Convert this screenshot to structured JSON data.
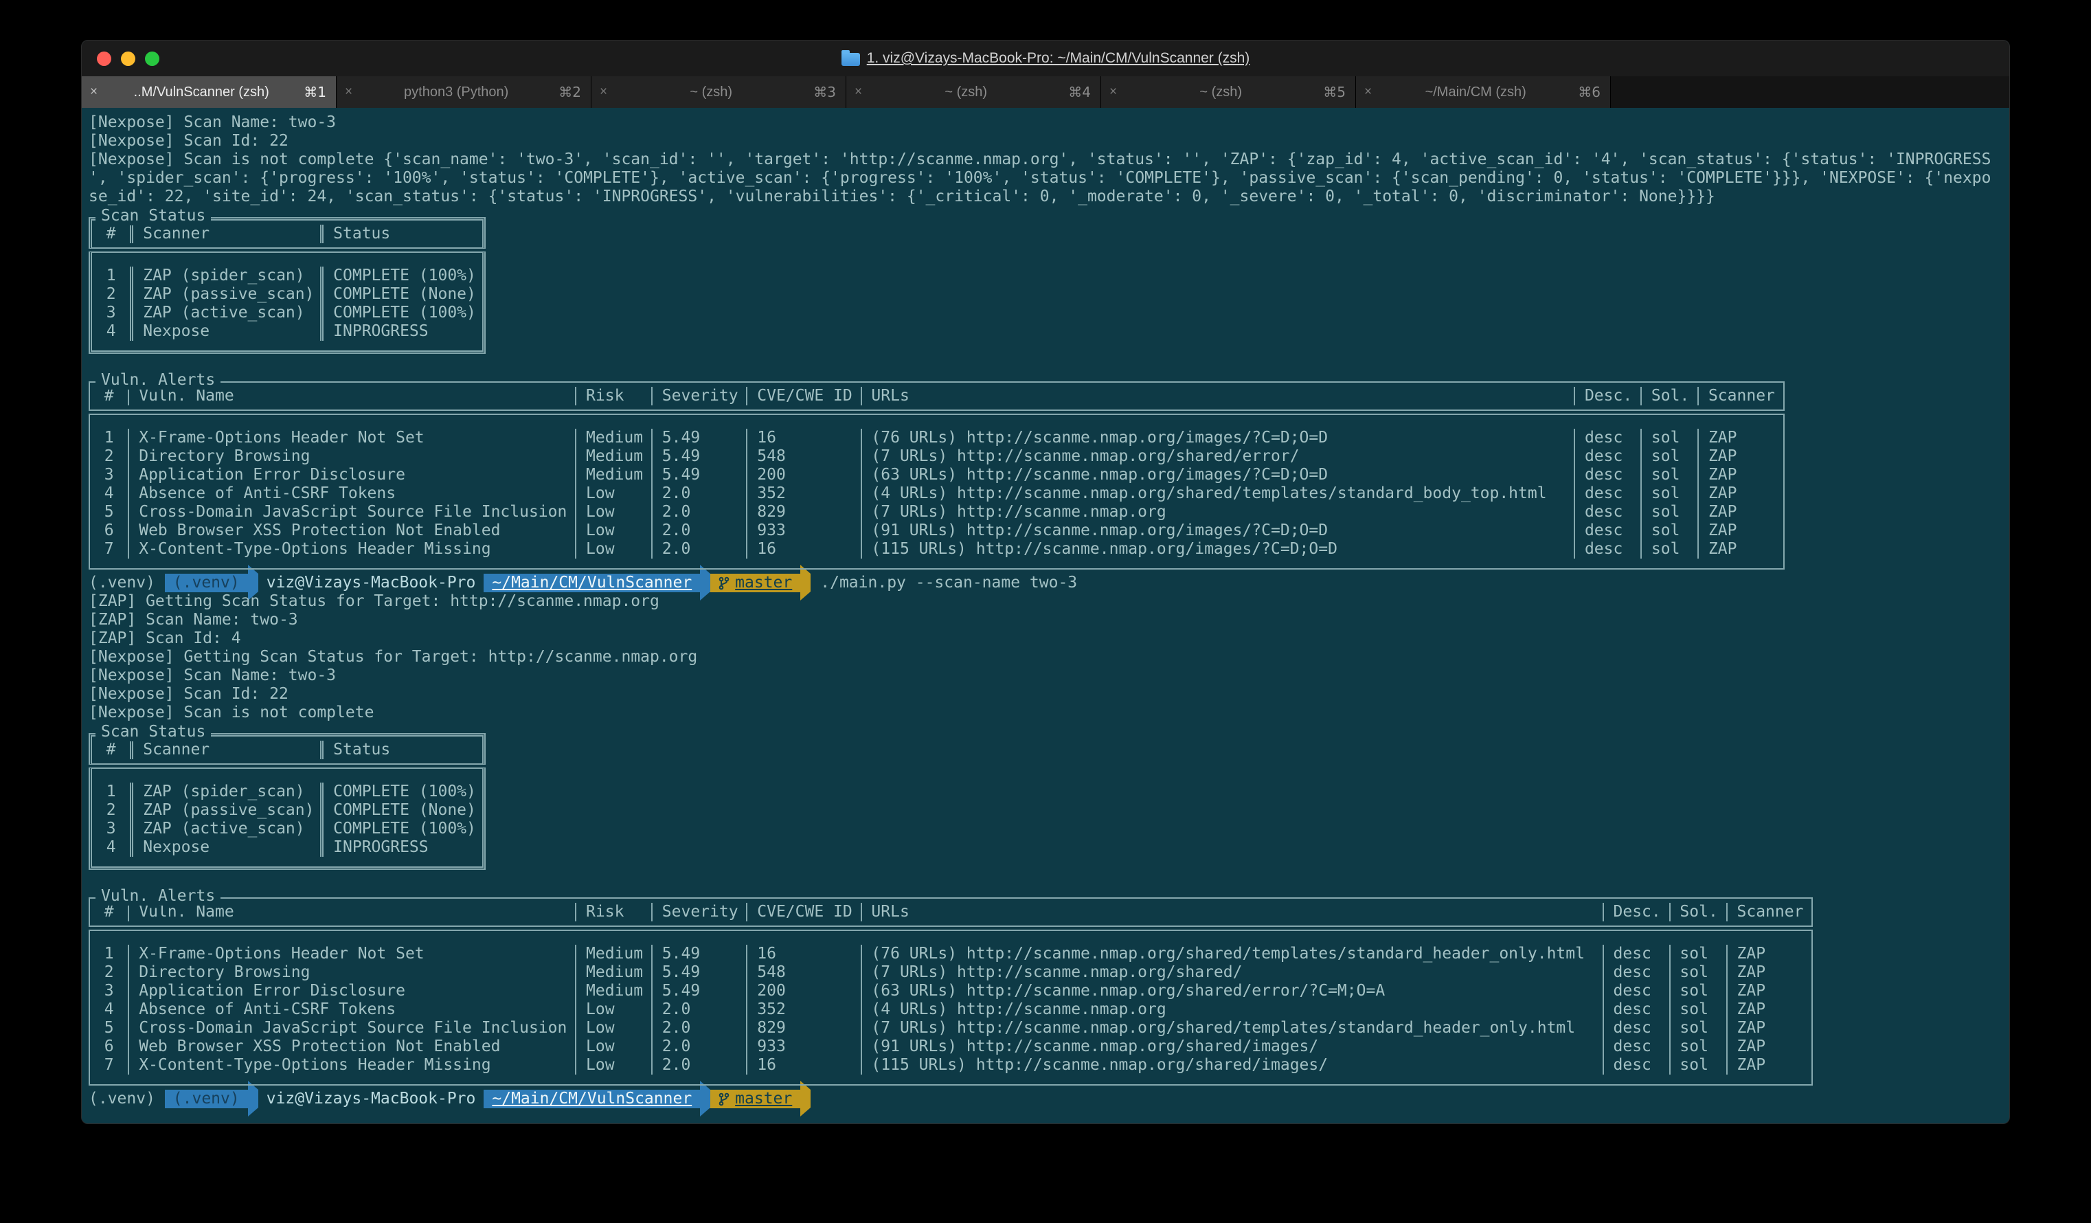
{
  "colors": {
    "bg": "#0e3a46",
    "text": "#a3c1c4",
    "line": "#85a8ae",
    "blue": "#2e7cb8",
    "blue-dark": "#16405c",
    "gold": "#c19a1e",
    "gold-text": "#123f4c"
  },
  "window": {
    "title": "1. viz@Vizays-MacBook-Pro: ~/Main/CM/VulnScanner (zsh)",
    "close_glyph": "×",
    "tabs": [
      {
        "label": "..M/VulnScanner (zsh)",
        "shortcut": "⌘1",
        "active": true
      },
      {
        "label": "python3 (Python)",
        "shortcut": "⌘2"
      },
      {
        "label": "~ (zsh)",
        "shortcut": "⌘3"
      },
      {
        "label": "~ (zsh)",
        "shortcut": "⌘4"
      },
      {
        "label": "~ (zsh)",
        "shortcut": "⌘5"
      },
      {
        "label": "~/Main/CM (zsh)",
        "shortcut": "⌘6"
      }
    ]
  },
  "terminal": {
    "pre_lines": [
      "[Nexpose] Scan Name: two-3",
      "[Nexpose] Scan Id: 22",
      "[Nexpose] Scan is not complete {'scan_name': 'two-3', 'scan_id': '', 'target': 'http://scanme.nmap.org', 'status': '', 'ZAP': {'zap_id': 4, 'active_scan_id': '4', 'scan_status': {'status': 'INPROGRESS",
      "', 'spider_scan': {'progress': '100%', 'status': 'COMPLETE'}, 'active_scan': {'progress': '100%', 'status': 'COMPLETE'}, 'passive_scan': {'scan_pending': 0, 'status': 'COMPLETE'}}}, 'NEXPOSE': {'nexpo",
      "se_id': 22, 'site_id': 24, 'scan_status': {'status': 'INPROGRESS', 'vulnerabilities': {'_critical': 0, '_moderate': 0, '_severe': 0, '_total': 0, 'discriminator': None}}}}"
    ],
    "scan_status_1": {
      "title": "Scan Status",
      "headers": [
        "#",
        "Scanner",
        "Status"
      ],
      "rows": [
        [
          "1",
          "ZAP (spider_scan)",
          "COMPLETE (100%)"
        ],
        [
          "2",
          "ZAP (passive_scan)",
          "COMPLETE (None)"
        ],
        [
          "3",
          "ZAP (active_scan)",
          "COMPLETE (100%)"
        ],
        [
          "4",
          "Nexpose",
          "INPROGRESS"
        ]
      ]
    },
    "vuln_table_1": {
      "title": "Vuln. Alerts",
      "headers": [
        "#",
        "Vuln. Name",
        "Risk",
        "Severity",
        "CVE/CWE ID",
        "URLs",
        "Desc.",
        "Sol.",
        "Scanner"
      ],
      "rows": [
        [
          "1",
          "X-Frame-Options Header Not Set",
          "Medium",
          "5.49",
          "16",
          "(76 URLs) http://scanme.nmap.org/images/?C=D;O=D",
          "desc",
          "sol",
          "ZAP"
        ],
        [
          "2",
          "Directory Browsing",
          "Medium",
          "5.49",
          "548",
          "(7 URLs) http://scanme.nmap.org/shared/error/",
          "desc",
          "sol",
          "ZAP"
        ],
        [
          "3",
          "Application Error Disclosure",
          "Medium",
          "5.49",
          "200",
          "(63 URLs) http://scanme.nmap.org/images/?C=D;O=D",
          "desc",
          "sol",
          "ZAP"
        ],
        [
          "4",
          "Absence of Anti-CSRF Tokens",
          "Low",
          "2.0",
          "352",
          "(4 URLs) http://scanme.nmap.org/shared/templates/standard_body_top.html",
          "desc",
          "sol",
          "ZAP"
        ],
        [
          "5",
          "Cross-Domain JavaScript Source File Inclusion",
          "Low",
          "2.0",
          "829",
          "(7 URLs) http://scanme.nmap.org",
          "desc",
          "sol",
          "ZAP"
        ],
        [
          "6",
          "Web Browser XSS Protection Not Enabled",
          "Low",
          "2.0",
          "933",
          "(91 URLs) http://scanme.nmap.org/images/?C=D;O=D",
          "desc",
          "sol",
          "ZAP"
        ],
        [
          "7",
          "X-Content-Type-Options Header Missing",
          "Low",
          "2.0",
          "16",
          "(115 URLs) http://scanme.nmap.org/images/?C=D;O=D",
          "desc",
          "sol",
          "ZAP"
        ]
      ]
    },
    "prompt1": {
      "prefix": "(.venv)",
      "venv": "(.venv)",
      "user_host": "viz@Vizays-MacBook-Pro",
      "path": "~/Main/CM/VulnScanner",
      "branch": "master",
      "command": "./main.py --scan-name two-3"
    },
    "mid_lines": [
      "[ZAP] Getting Scan Status for Target: http://scanme.nmap.org",
      "[ZAP] Scan Name: two-3",
      "[ZAP] Scan Id: 4",
      "[Nexpose] Getting Scan Status for Target: http://scanme.nmap.org",
      "[Nexpose] Scan Name: two-3",
      "[Nexpose] Scan Id: 22",
      "[Nexpose] Scan is not complete"
    ],
    "scan_status_2": {
      "title": "Scan Status",
      "headers": [
        "#",
        "Scanner",
        "Status"
      ],
      "rows": [
        [
          "1",
          "ZAP (spider_scan)",
          "COMPLETE (100%)"
        ],
        [
          "2",
          "ZAP (passive_scan)",
          "COMPLETE (None)"
        ],
        [
          "3",
          "ZAP (active_scan)",
          "COMPLETE (100%)"
        ],
        [
          "4",
          "Nexpose",
          "INPROGRESS"
        ]
      ]
    },
    "vuln_table_2": {
      "title": "Vuln. Alerts",
      "headers": [
        "#",
        "Vuln. Name",
        "Risk",
        "Severity",
        "CVE/CWE ID",
        "URLs",
        "Desc.",
        "Sol.",
        "Scanner"
      ],
      "rows": [
        [
          "1",
          "X-Frame-Options Header Not Set",
          "Medium",
          "5.49",
          "16",
          "(76 URLs) http://scanme.nmap.org/shared/templates/standard_header_only.html",
          "desc",
          "sol",
          "ZAP"
        ],
        [
          "2",
          "Directory Browsing",
          "Medium",
          "5.49",
          "548",
          "(7 URLs) http://scanme.nmap.org/shared/",
          "desc",
          "sol",
          "ZAP"
        ],
        [
          "3",
          "Application Error Disclosure",
          "Medium",
          "5.49",
          "200",
          "(63 URLs) http://scanme.nmap.org/shared/error/?C=M;O=A",
          "desc",
          "sol",
          "ZAP"
        ],
        [
          "4",
          "Absence of Anti-CSRF Tokens",
          "Low",
          "2.0",
          "352",
          "(4 URLs) http://scanme.nmap.org",
          "desc",
          "sol",
          "ZAP"
        ],
        [
          "5",
          "Cross-Domain JavaScript Source File Inclusion",
          "Low",
          "2.0",
          "829",
          "(7 URLs) http://scanme.nmap.org/shared/templates/standard_header_only.html",
          "desc",
          "sol",
          "ZAP"
        ],
        [
          "6",
          "Web Browser XSS Protection Not Enabled",
          "Low",
          "2.0",
          "933",
          "(91 URLs) http://scanme.nmap.org/shared/images/",
          "desc",
          "sol",
          "ZAP"
        ],
        [
          "7",
          "X-Content-Type-Options Header Missing",
          "Low",
          "2.0",
          "16",
          "(115 URLs) http://scanme.nmap.org/shared/images/",
          "desc",
          "sol",
          "ZAP"
        ]
      ]
    },
    "prompt2": {
      "prefix": "(.venv)",
      "venv": "(.venv)",
      "user_host": "viz@Vizays-MacBook-Pro",
      "path": "~/Main/CM/VulnScanner",
      "branch": "master"
    }
  }
}
